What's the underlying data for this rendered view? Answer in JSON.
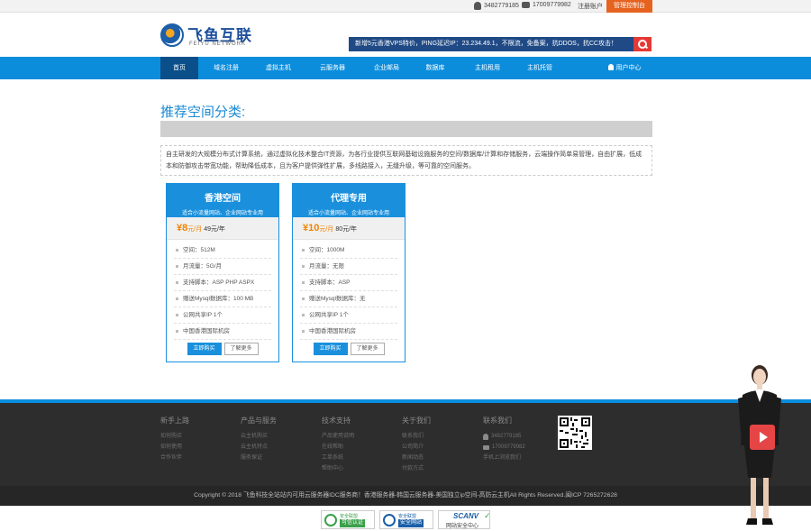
{
  "topbar": {
    "qq": "3482779185",
    "phone": "17009779982",
    "register": "注册账户",
    "control_panel": "管理控制台"
  },
  "header": {
    "logo_cn": "飞鱼互联",
    "logo_en": "FEIYU NETWORK",
    "notice": "新增5元香港VPS特价，PING延迟IP：23.234.49.1，不限流，免备案，抗DDOS，抗CC攻击！"
  },
  "nav": {
    "items": [
      "首页",
      "域名注册",
      "虚拟主机",
      "云服务器",
      "企业邮局",
      "数据库",
      "主机租用",
      "主机托管"
    ],
    "user_center": "用户中心"
  },
  "main": {
    "section_title": "推荐空间分类:",
    "description": "自主研发的大规模分布式计算系统，通过虚拟化技术整合IT资源，为各行业提供互联网基础设施服务的空间/数据库/计算和存储服务，云端操作简单易管理，自由扩展，低成本和防御攻击带宽功能，帮助降低成本，且为客户提供弹性扩展，多线路接入，无缝升级，等可靠的空间服务。"
  },
  "plans": [
    {
      "title": "香港空间",
      "subtitle": "适合小流量网站、企业网站专业用",
      "price": "¥8",
      "price_unit": "元/月",
      "price_year": "49元/年",
      "features": [
        "空间：512M",
        "月流量：5G/月",
        "支持脚本：ASP PHP ASPX",
        "赠送Mysql数据库：100 MB",
        "公网共享IP 1个",
        "中国香港国际机房"
      ],
      "buy_label": "立即购买",
      "more_label": "了解更多"
    },
    {
      "title": "代理专用",
      "subtitle": "适合小流量网站、企业网站专业用",
      "price": "¥10",
      "price_unit": "元/月",
      "price_year": "80元/年",
      "features": [
        "空间：1000M",
        "月流量：无限",
        "支持脚本：ASP",
        "赠送Mysql数据库：无",
        "公网共享IP 1个",
        "中国香港国际机房"
      ],
      "buy_label": "立即购买",
      "more_label": "了解更多"
    }
  ],
  "footer": {
    "columns": [
      {
        "title": "新手上路",
        "links": [
          "如何购买",
          "如何使用",
          "合作伙伴"
        ]
      },
      {
        "title": "产品与服务",
        "links": [
          "云主机购买",
          "云主机特点",
          "服务保证"
        ]
      },
      {
        "title": "技术支持",
        "links": [
          "产品使用说明",
          "在线帮助",
          "工单系统",
          "帮助中心"
        ]
      },
      {
        "title": "关于我们",
        "links": [
          "联系我们",
          "公司简介",
          "新闻动态",
          "付款方式"
        ]
      }
    ],
    "contact": {
      "title": "联系我们",
      "qq": "3482779185",
      "phone": "17009779982",
      "mobile": "手机上浏览我们"
    },
    "copyright": "Copyright © 2018 飞鱼科技全站站内可用云服务器IDC服务商！香港服务器-韩国云服务器-美国独立ip空间-高防云主机All Rights Reserved.闽ICP 7265272628",
    "badges": [
      {
        "line1": "安全联盟",
        "line2": "可信认证"
      },
      {
        "line1": "安全联盟",
        "line2": "安全网站"
      }
    ],
    "scan": {
      "title": "SCANV",
      "subtitle": "网站安全中心"
    }
  },
  "colors": {
    "primary": "#0c8ddc",
    "nav_active": "#0a4f8a",
    "accent_orange": "#e6621f",
    "price_orange": "#f08300",
    "footer_bg": "#2d2d2d"
  }
}
